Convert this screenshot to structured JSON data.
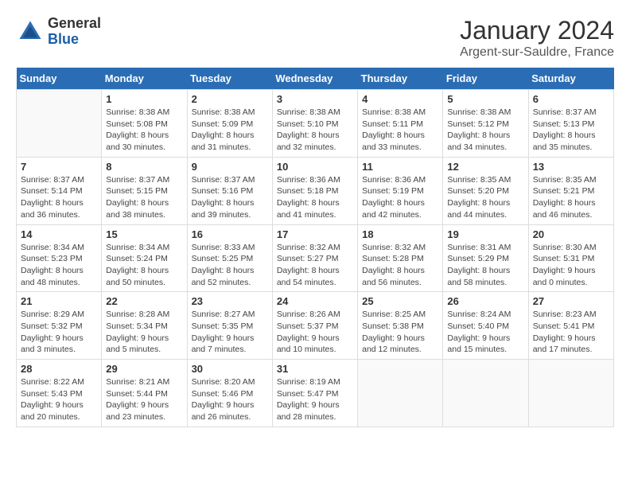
{
  "header": {
    "logo": {
      "general": "General",
      "blue": "Blue"
    },
    "title": "January 2024",
    "location": "Argent-sur-Sauldre, France"
  },
  "days_of_week": [
    "Sunday",
    "Monday",
    "Tuesday",
    "Wednesday",
    "Thursday",
    "Friday",
    "Saturday"
  ],
  "weeks": [
    [
      {
        "day": "",
        "info": ""
      },
      {
        "day": "1",
        "info": "Sunrise: 8:38 AM\nSunset: 5:08 PM\nDaylight: 8 hours\nand 30 minutes."
      },
      {
        "day": "2",
        "info": "Sunrise: 8:38 AM\nSunset: 5:09 PM\nDaylight: 8 hours\nand 31 minutes."
      },
      {
        "day": "3",
        "info": "Sunrise: 8:38 AM\nSunset: 5:10 PM\nDaylight: 8 hours\nand 32 minutes."
      },
      {
        "day": "4",
        "info": "Sunrise: 8:38 AM\nSunset: 5:11 PM\nDaylight: 8 hours\nand 33 minutes."
      },
      {
        "day": "5",
        "info": "Sunrise: 8:38 AM\nSunset: 5:12 PM\nDaylight: 8 hours\nand 34 minutes."
      },
      {
        "day": "6",
        "info": "Sunrise: 8:37 AM\nSunset: 5:13 PM\nDaylight: 8 hours\nand 35 minutes."
      }
    ],
    [
      {
        "day": "7",
        "info": "Sunrise: 8:37 AM\nSunset: 5:14 PM\nDaylight: 8 hours\nand 36 minutes."
      },
      {
        "day": "8",
        "info": "Sunrise: 8:37 AM\nSunset: 5:15 PM\nDaylight: 8 hours\nand 38 minutes."
      },
      {
        "day": "9",
        "info": "Sunrise: 8:37 AM\nSunset: 5:16 PM\nDaylight: 8 hours\nand 39 minutes."
      },
      {
        "day": "10",
        "info": "Sunrise: 8:36 AM\nSunset: 5:18 PM\nDaylight: 8 hours\nand 41 minutes."
      },
      {
        "day": "11",
        "info": "Sunrise: 8:36 AM\nSunset: 5:19 PM\nDaylight: 8 hours\nand 42 minutes."
      },
      {
        "day": "12",
        "info": "Sunrise: 8:35 AM\nSunset: 5:20 PM\nDaylight: 8 hours\nand 44 minutes."
      },
      {
        "day": "13",
        "info": "Sunrise: 8:35 AM\nSunset: 5:21 PM\nDaylight: 8 hours\nand 46 minutes."
      }
    ],
    [
      {
        "day": "14",
        "info": "Sunrise: 8:34 AM\nSunset: 5:23 PM\nDaylight: 8 hours\nand 48 minutes."
      },
      {
        "day": "15",
        "info": "Sunrise: 8:34 AM\nSunset: 5:24 PM\nDaylight: 8 hours\nand 50 minutes."
      },
      {
        "day": "16",
        "info": "Sunrise: 8:33 AM\nSunset: 5:25 PM\nDaylight: 8 hours\nand 52 minutes."
      },
      {
        "day": "17",
        "info": "Sunrise: 8:32 AM\nSunset: 5:27 PM\nDaylight: 8 hours\nand 54 minutes."
      },
      {
        "day": "18",
        "info": "Sunrise: 8:32 AM\nSunset: 5:28 PM\nDaylight: 8 hours\nand 56 minutes."
      },
      {
        "day": "19",
        "info": "Sunrise: 8:31 AM\nSunset: 5:29 PM\nDaylight: 8 hours\nand 58 minutes."
      },
      {
        "day": "20",
        "info": "Sunrise: 8:30 AM\nSunset: 5:31 PM\nDaylight: 9 hours\nand 0 minutes."
      }
    ],
    [
      {
        "day": "21",
        "info": "Sunrise: 8:29 AM\nSunset: 5:32 PM\nDaylight: 9 hours\nand 3 minutes."
      },
      {
        "day": "22",
        "info": "Sunrise: 8:28 AM\nSunset: 5:34 PM\nDaylight: 9 hours\nand 5 minutes."
      },
      {
        "day": "23",
        "info": "Sunrise: 8:27 AM\nSunset: 5:35 PM\nDaylight: 9 hours\nand 7 minutes."
      },
      {
        "day": "24",
        "info": "Sunrise: 8:26 AM\nSunset: 5:37 PM\nDaylight: 9 hours\nand 10 minutes."
      },
      {
        "day": "25",
        "info": "Sunrise: 8:25 AM\nSunset: 5:38 PM\nDaylight: 9 hours\nand 12 minutes."
      },
      {
        "day": "26",
        "info": "Sunrise: 8:24 AM\nSunset: 5:40 PM\nDaylight: 9 hours\nand 15 minutes."
      },
      {
        "day": "27",
        "info": "Sunrise: 8:23 AM\nSunset: 5:41 PM\nDaylight: 9 hours\nand 17 minutes."
      }
    ],
    [
      {
        "day": "28",
        "info": "Sunrise: 8:22 AM\nSunset: 5:43 PM\nDaylight: 9 hours\nand 20 minutes."
      },
      {
        "day": "29",
        "info": "Sunrise: 8:21 AM\nSunset: 5:44 PM\nDaylight: 9 hours\nand 23 minutes."
      },
      {
        "day": "30",
        "info": "Sunrise: 8:20 AM\nSunset: 5:46 PM\nDaylight: 9 hours\nand 26 minutes."
      },
      {
        "day": "31",
        "info": "Sunrise: 8:19 AM\nSunset: 5:47 PM\nDaylight: 9 hours\nand 28 minutes."
      },
      {
        "day": "",
        "info": ""
      },
      {
        "day": "",
        "info": ""
      },
      {
        "day": "",
        "info": ""
      }
    ]
  ]
}
